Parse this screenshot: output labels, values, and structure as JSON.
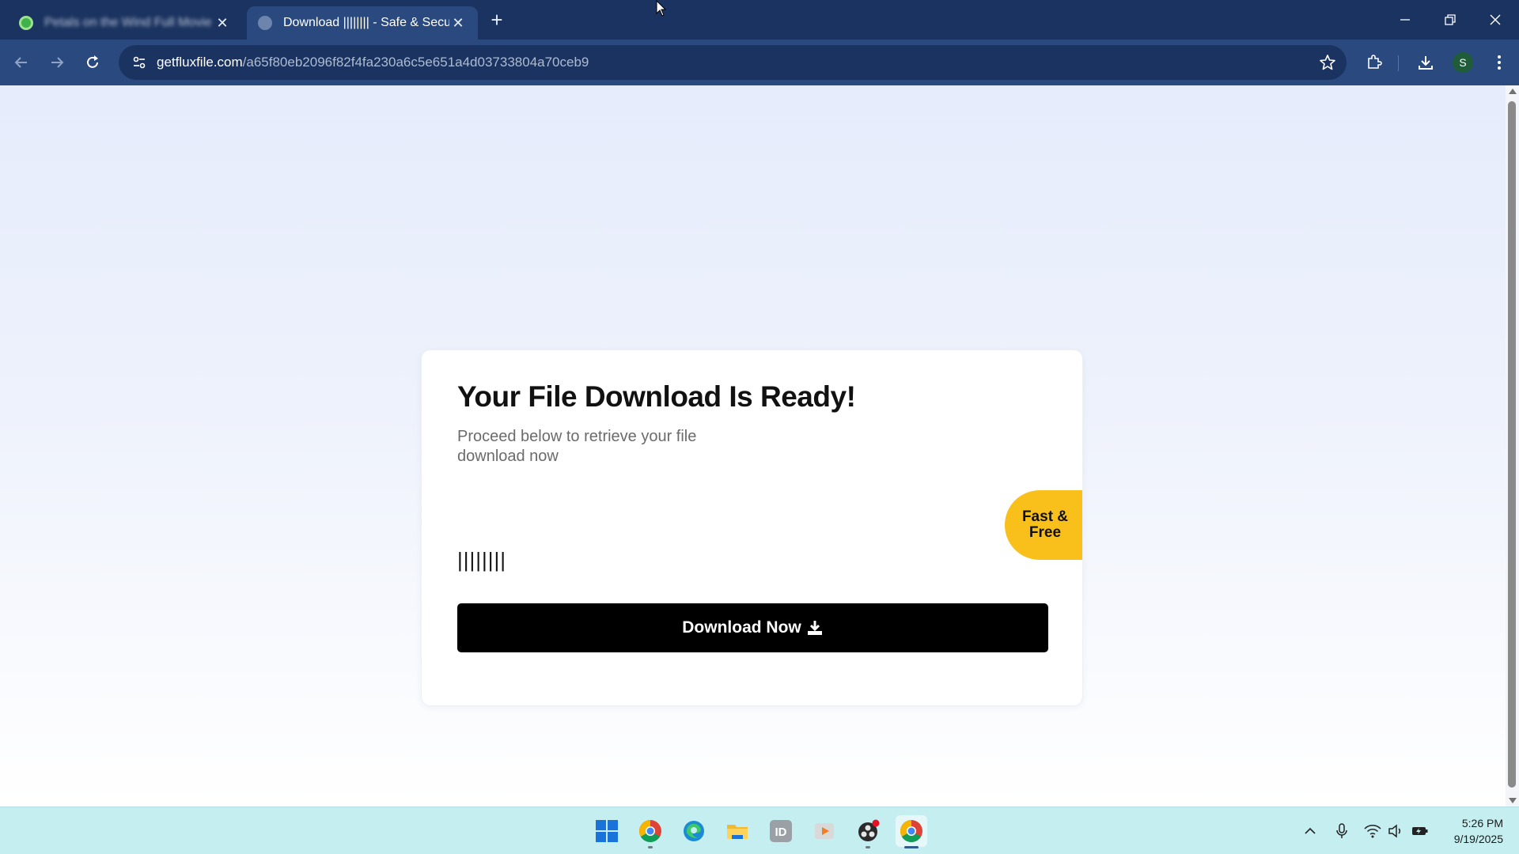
{
  "browser": {
    "tabs": [
      {
        "title": "Petals on the Wind Full Movie",
        "active": false
      },
      {
        "title": "Download |||||||| - Safe & Secure",
        "active": true
      }
    ],
    "url_host": "getfluxfile.com",
    "url_path": "/a65f80eb2096f82f4fa230a6c5e651a4d03733804a70ceb9",
    "profile_initial": "S"
  },
  "page": {
    "title": "Your File Download Is Ready!",
    "subtitle": "Proceed below to retrieve your file download now",
    "badge": "Fast & Free",
    "filename": "||||||||",
    "download_label": "Download Now"
  },
  "taskbar": {
    "apps": [
      "windows-start",
      "chrome",
      "edge",
      "file-explorer",
      "indesign",
      "media-player",
      "obs",
      "chrome-active"
    ],
    "time": "5:26 PM",
    "date": "9/19/2025"
  },
  "colors": {
    "tab_strip": "#1b3360",
    "toolbar": "#2a4a7f",
    "badge": "#f9c01b",
    "button": "#000000",
    "taskbar": "#c5eef0"
  }
}
